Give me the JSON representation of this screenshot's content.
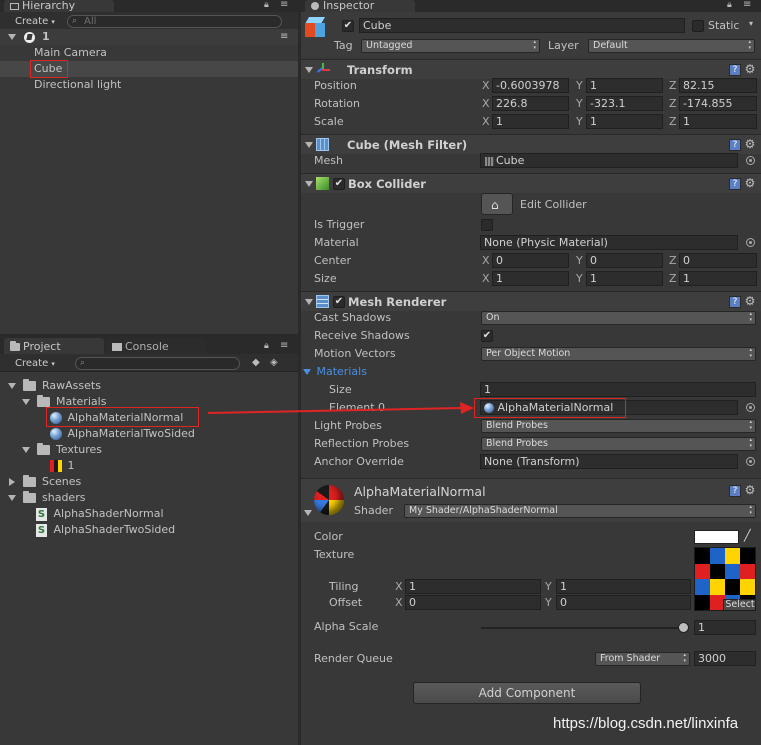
{
  "hierarchy": {
    "tab_label": "Hierarchy",
    "create_label": "Create",
    "search_placeholder": "All",
    "scene_name": "1",
    "items": [
      "Main Camera",
      "Cube",
      "Directional light"
    ]
  },
  "project": {
    "tab_label": "Project",
    "console_tab_label": "Console",
    "create_label": "Create",
    "tree": {
      "rawassets": "RawAssets",
      "materials": "Materials",
      "material_normal": "AlphaMaterialNormal",
      "material_twosided": "AlphaMaterialTwoSided",
      "textures": "Textures",
      "texture_1": "1",
      "scenes": "Scenes",
      "shaders": "shaders",
      "shader_normal": "AlphaShaderNormal",
      "shader_twosided": "AlphaShaderTwoSided"
    }
  },
  "inspector": {
    "tab_label": "Inspector",
    "object_name": "Cube",
    "static_label": "Static",
    "tag_label": "Tag",
    "tag_value": "Untagged",
    "layer_label": "Layer",
    "layer_value": "Default",
    "transform": {
      "title": "Transform",
      "position_label": "Position",
      "rotation_label": "Rotation",
      "scale_label": "Scale",
      "position": {
        "x": "-0.6003978",
        "y": "1",
        "z": "82.15"
      },
      "rotation": {
        "x": "226.8",
        "y": "-323.1",
        "z": "-174.855"
      },
      "scale": {
        "x": "1",
        "y": "1",
        "z": "1"
      }
    },
    "mesh_filter": {
      "title": "Cube (Mesh Filter)",
      "mesh_label": "Mesh",
      "mesh_value": "Cube"
    },
    "box_collider": {
      "title": "Box Collider",
      "edit_collider": "Edit Collider",
      "is_trigger_label": "Is Trigger",
      "material_label": "Material",
      "material_value": "None (Physic Material)",
      "center_label": "Center",
      "center": {
        "x": "0",
        "y": "0",
        "z": "0"
      },
      "size_label": "Size",
      "size": {
        "x": "1",
        "y": "1",
        "z": "1"
      }
    },
    "mesh_renderer": {
      "title": "Mesh Renderer",
      "cast_shadows_label": "Cast Shadows",
      "cast_shadows_value": "On",
      "receive_shadows_label": "Receive Shadows",
      "motion_vectors_label": "Motion Vectors",
      "motion_vectors_value": "Per Object Motion",
      "materials_label": "Materials",
      "size_label": "Size",
      "size_value": "1",
      "element0_label": "Element 0",
      "element0_value": "AlphaMaterialNormal",
      "light_probes_label": "Light Probes",
      "light_probes_value": "Blend Probes",
      "reflection_probes_label": "Reflection Probes",
      "reflection_probes_value": "Blend Probes",
      "anchor_override_label": "Anchor Override",
      "anchor_override_value": "None (Transform)"
    },
    "material": {
      "name": "AlphaMaterialNormal",
      "shader_label": "Shader",
      "shader_value": "My Shader/AlphaShaderNormal",
      "color_label": "Color",
      "texture_label": "Texture",
      "tiling_label": "Tiling",
      "offset_label": "Offset",
      "tiling": {
        "x": "1",
        "y": "1"
      },
      "offset": {
        "x": "0",
        "y": "0"
      },
      "select_label": "Select",
      "alpha_scale_label": "Alpha Scale",
      "alpha_scale_value": "1",
      "alpha_scale_fraction": 1.0,
      "render_queue_label": "Render Queue",
      "render_queue_mode": "From Shader",
      "render_queue_value": "3000"
    },
    "add_component_label": "Add Component"
  },
  "labels": {
    "x": "X",
    "y": "Y",
    "z": "Z"
  },
  "watermark": "https://blog.csdn.net/linxinfa",
  "colors": {
    "highlight_red": "#e02424",
    "materials_blue": "#4a8fe0",
    "panel_bg": "#383838"
  }
}
